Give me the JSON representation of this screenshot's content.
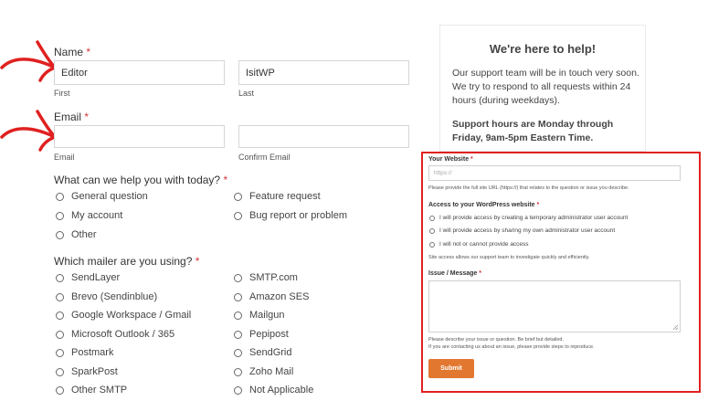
{
  "form": {
    "name": {
      "label": "Name",
      "required": "*",
      "first_value": "Editor",
      "last_value": "IsitWP",
      "first_sub": "First",
      "last_sub": "Last"
    },
    "email": {
      "label": "Email",
      "required": "*",
      "email_sub": "Email",
      "confirm_sub": "Confirm Email"
    },
    "help_question": {
      "label": "What can we help you with today?",
      "required": "*",
      "options_left": [
        "General question",
        "My account",
        "Other"
      ],
      "options_right": [
        "Feature request",
        "Bug report or problem"
      ]
    },
    "mailer_question": {
      "label": "Which mailer are you using?",
      "required": "*",
      "options_left": [
        "SendLayer",
        "Brevo (Sendinblue)",
        "Google Workspace / Gmail",
        "Microsoft Outlook / 365",
        "Postmark",
        "SparkPost",
        "Other SMTP"
      ],
      "options_right": [
        "SMTP.com",
        "Amazon SES",
        "Mailgun",
        "Pepipost",
        "SendGrid",
        "Zoho Mail",
        "Not Applicable"
      ]
    }
  },
  "help_box": {
    "title": "We're here to help!",
    "text": "Our support team will be in touch very soon. We try to respond to all requests within 24 hours (during weekdays).",
    "hours": "Support hours are Monday through Friday, 9am-5pm Eastern Time."
  },
  "panel": {
    "website": {
      "label": "Your Website",
      "required": "*",
      "placeholder": "https://",
      "sub": "Please provide the full site URL (https://) that relates to the question or issue you describe."
    },
    "access": {
      "label": "Access to your WordPress website",
      "required": "*",
      "options": [
        "I will provide access by creating a temporary administrator user account",
        "I will provide access by sharing my own administrator user account",
        "I will not or cannot provide access"
      ],
      "sub": "Site access allows our support team to investigate quickly and efficiently."
    },
    "issue": {
      "label": "Issue / Message",
      "required": "*",
      "sub1": "Please describe your issue or question. Be brief but detailed.",
      "sub2": "If you are contacting us about an issue, please provide steps to reproduce."
    },
    "submit_label": "Submit"
  },
  "colors": {
    "accent": "#e27730",
    "highlight": "#e02020",
    "arrow": "#e02020",
    "required": "#d63638"
  },
  "icons": [
    "arrow-pointer-icon",
    "arrow-pointer-icon"
  ]
}
